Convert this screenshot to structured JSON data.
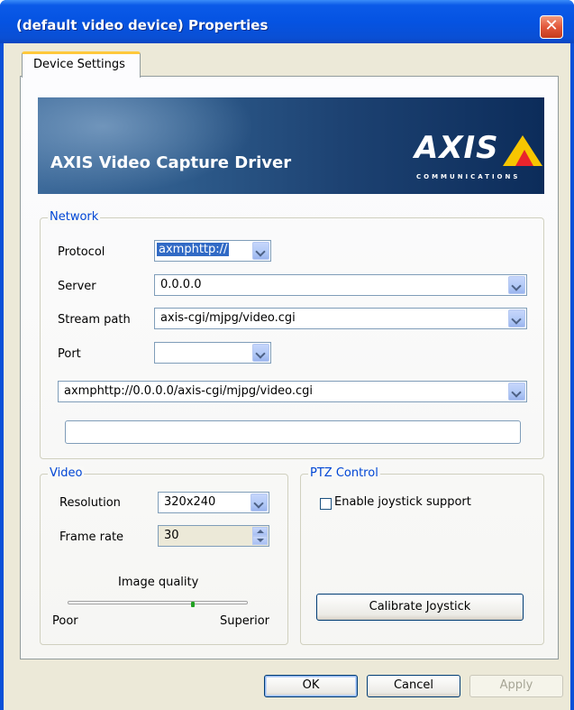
{
  "window": {
    "title": "(default video device) Properties",
    "close_glyph": "✕"
  },
  "tabs": [
    {
      "label": "Device Settings"
    }
  ],
  "banner": {
    "title": "AXIS Video Capture Driver",
    "logo_text": "AXIS",
    "logo_subtext": "COMMUNICATIONS"
  },
  "network": {
    "group_label": "Network",
    "protocol": {
      "label": "Protocol",
      "value": "axmphttp://"
    },
    "server": {
      "label": "Server",
      "value": "0.0.0.0"
    },
    "stream_path": {
      "label": "Stream path",
      "value": "axis-cgi/mjpg/video.cgi"
    },
    "port": {
      "label": "Port",
      "value": ""
    },
    "full_url": "axmphttp://0.0.0.0/axis-cgi/mjpg/video.cgi",
    "status_text": ""
  },
  "video": {
    "group_label": "Video",
    "resolution": {
      "label": "Resolution",
      "value": "320x240"
    },
    "frame_rate": {
      "label": "Frame rate",
      "value": "30"
    },
    "image_quality": {
      "label": "Image quality",
      "min_label": "Poor",
      "max_label": "Superior",
      "level": 0.7
    }
  },
  "ptz": {
    "group_label": "PTZ Control",
    "joystick_label": "Enable joystick support",
    "joystick_checked": false,
    "calibrate_label": "Calibrate Joystick"
  },
  "buttons": {
    "ok": "OK",
    "cancel": "Cancel",
    "apply": "Apply"
  },
  "colors": {
    "title_bar": "#0553e2",
    "group_label": "#0046d5",
    "dialog_bg": "#ece9d8"
  }
}
